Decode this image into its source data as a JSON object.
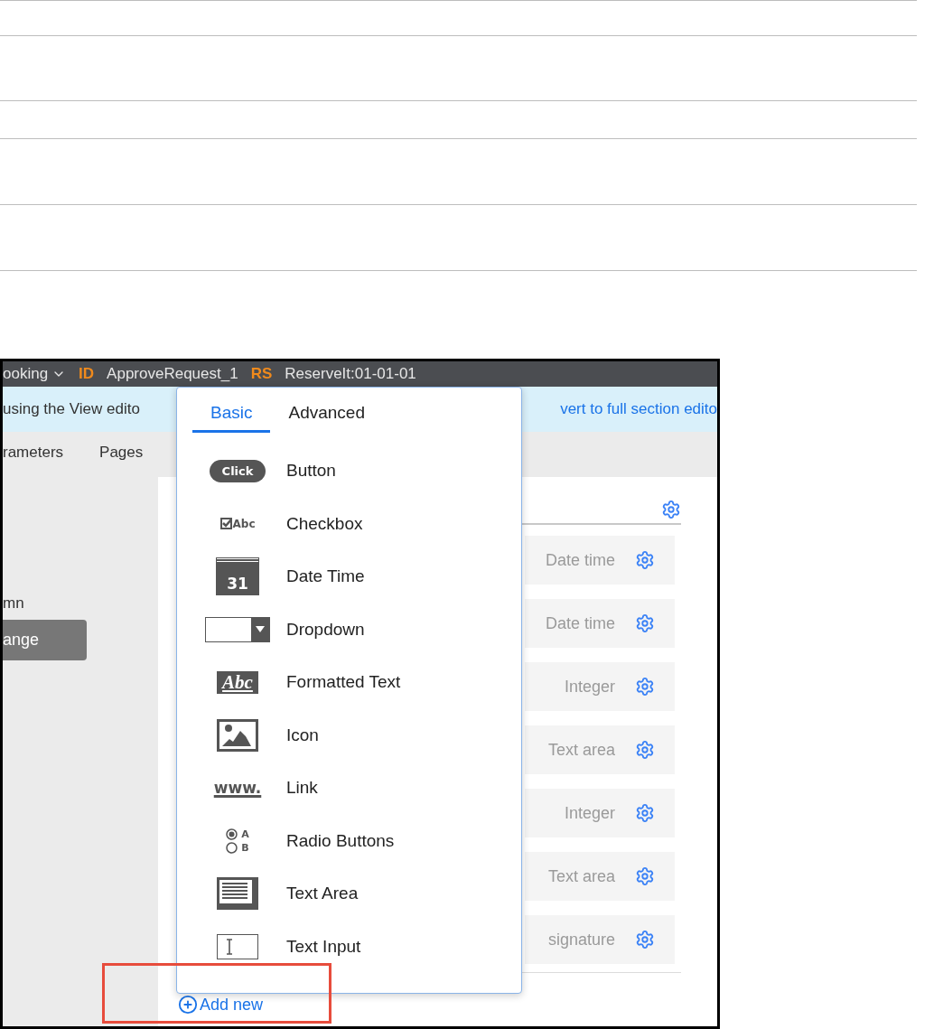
{
  "header": {
    "items": [
      {
        "text": "ooking",
        "kind": "menu"
      },
      {
        "text": "ID",
        "kind": "tag"
      },
      {
        "text": "ApproveRequest_1",
        "kind": "value"
      },
      {
        "text": "RS",
        "kind": "tag"
      },
      {
        "text": "ReserveIt:01-01-01",
        "kind": "value"
      }
    ]
  },
  "banner": {
    "message": "using the View edito",
    "link": "vert to full section edito"
  },
  "tabs": [
    {
      "label": "rameters"
    },
    {
      "label": "Pages"
    }
  ],
  "left_panel": {
    "label": "mn",
    "button": "ange"
  },
  "fields": {
    "rows": [
      {
        "type": "Date time"
      },
      {
        "type": "Date time"
      },
      {
        "type": "Integer"
      },
      {
        "type": "Text area"
      },
      {
        "type": "Integer"
      },
      {
        "type": "Text area"
      },
      {
        "type": "signature"
      }
    ],
    "add_new": "Add new"
  },
  "popover": {
    "tabs": [
      {
        "label": "Basic",
        "selected": true
      },
      {
        "label": "Advanced",
        "selected": false
      }
    ],
    "items": [
      {
        "label": "Button",
        "kind": "button",
        "icon_text": "Click"
      },
      {
        "label": "Checkbox",
        "kind": "checkbox",
        "icon_text": "Abc"
      },
      {
        "label": "Date Time",
        "kind": "date",
        "icon_text": "31"
      },
      {
        "label": "Dropdown",
        "kind": "dropdown"
      },
      {
        "label": "Formatted Text",
        "kind": "formatted",
        "icon_text": "Abc"
      },
      {
        "label": "Icon",
        "kind": "image"
      },
      {
        "label": "Link",
        "kind": "link",
        "icon_text": "www."
      },
      {
        "label": "Radio Buttons",
        "kind": "radio",
        "options": [
          "A",
          "B"
        ]
      },
      {
        "label": "Text Area",
        "kind": "textarea"
      },
      {
        "label": "Text Input",
        "kind": "textinput"
      }
    ]
  }
}
